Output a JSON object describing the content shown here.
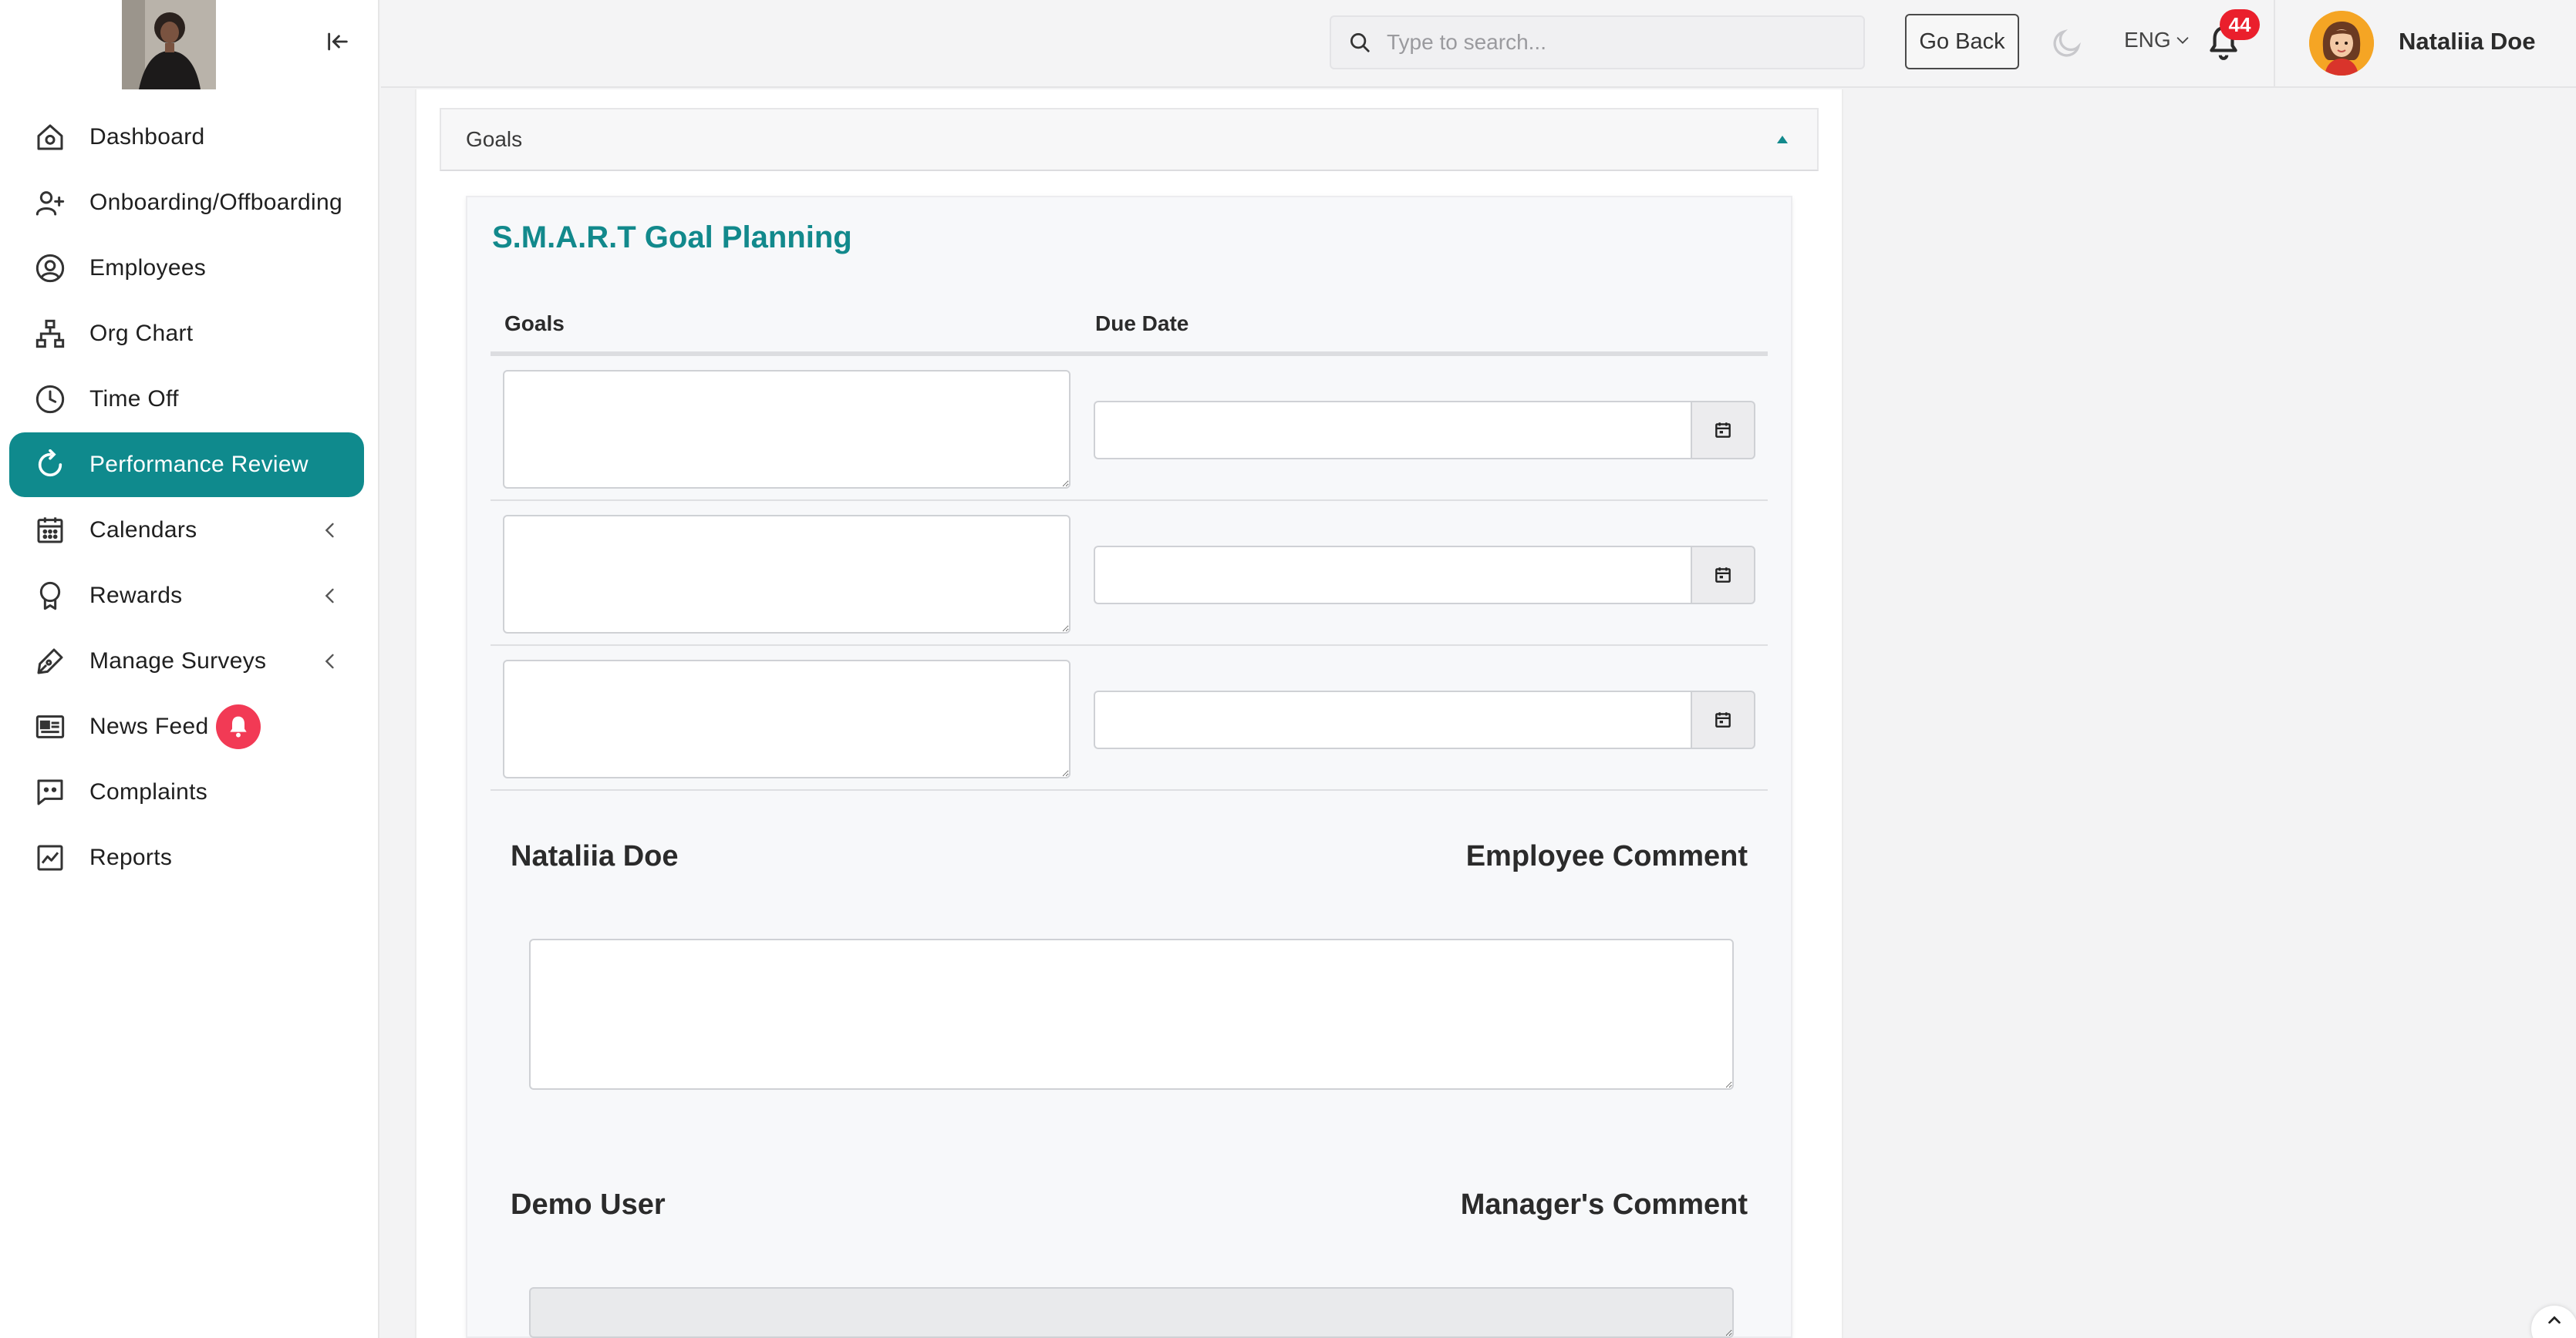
{
  "sidebar": {
    "items": [
      {
        "label": "Dashboard",
        "icon": "home-icon"
      },
      {
        "label": "Onboarding/Offboarding",
        "icon": "user-plus-icon"
      },
      {
        "label": "Employees",
        "icon": "user-circle-icon"
      },
      {
        "label": "Org Chart",
        "icon": "org-chart-icon"
      },
      {
        "label": "Time Off",
        "icon": "clock-icon"
      },
      {
        "label": "Performance Review",
        "icon": "refresh-icon",
        "active": true
      },
      {
        "label": "Calendars",
        "icon": "calendar-icon",
        "expandable": true
      },
      {
        "label": "Rewards",
        "icon": "award-icon",
        "expandable": true
      },
      {
        "label": "Manage Surveys",
        "icon": "pen-icon",
        "expandable": true
      },
      {
        "label": "News Feed",
        "icon": "newspaper-icon",
        "badge_icon": "bell-icon"
      },
      {
        "label": "Complaints",
        "icon": "chat-icon"
      },
      {
        "label": "Reports",
        "icon": "chart-icon"
      }
    ]
  },
  "header": {
    "search_placeholder": "Type to search...",
    "go_back_label": "Go Back",
    "language": "ENG",
    "notification_count": "44",
    "user_name": "Nataliia Doe"
  },
  "goals_section": {
    "header_label": "Goals",
    "card_title": "S.M.A.R.T Goal Planning",
    "columns": {
      "goals": "Goals",
      "due_date": "Due Date"
    },
    "rows": [
      {
        "goal": "",
        "due_date": ""
      },
      {
        "goal": "",
        "due_date": ""
      },
      {
        "goal": "",
        "due_date": ""
      }
    ]
  },
  "employee_comment": {
    "name": "Nataliia Doe",
    "label": "Employee Comment",
    "value": ""
  },
  "manager_comment": {
    "name": "Demo User",
    "label": "Manager's Comment",
    "value": ""
  },
  "colors": {
    "accent": "#0f8a8d",
    "badge_red": "#f23a55",
    "notification_red": "#ea1f2c",
    "avatar_bg": "#f5a524"
  }
}
